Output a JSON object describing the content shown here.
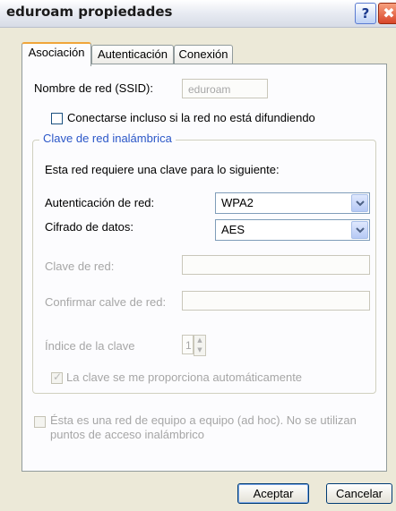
{
  "window": {
    "title": "eduroam propiedades"
  },
  "titlebar": {
    "help_glyph": "?",
    "close_glyph": "✖"
  },
  "tabs": [
    {
      "label": "Asociación",
      "active": true
    },
    {
      "label": "Autenticación",
      "active": false
    },
    {
      "label": "Conexión",
      "active": false
    }
  ],
  "ssid": {
    "label": "Nombre de red (SSID):",
    "value": "eduroam"
  },
  "broadcast_checkbox": {
    "label": "Conectarse incluso si la red no está difundiendo",
    "checked": false
  },
  "wireless_key": {
    "legend": "Clave de red inalámbrica",
    "intro": "Esta red requiere una clave para lo siguiente:",
    "auth_label": "Autenticación de red:",
    "auth_value": "WPA2",
    "cipher_label": "Cifrado de datos:",
    "cipher_value": "AES",
    "key_label": "Clave de red:",
    "confirm_label": "Confirmar calve de red:",
    "index_label": "Índice de la clave",
    "index_value": "1",
    "auto_key_label": "La clave se me proporciona automáticamente",
    "auto_key_checked": true
  },
  "adhoc": {
    "line1": "Ésta es una red de equipo a equipo (ad hoc). No se utilizan",
    "line2": "puntos de acceso inalámbrico",
    "checked": false
  },
  "buttons": {
    "ok": "Aceptar",
    "cancel": "Cancelar"
  },
  "colors": {
    "dialog_bg": "#ece9d8",
    "groupbox_label": "#2b57c8",
    "disabled_text": "#a6a6a6"
  },
  "icons": [
    "help-icon",
    "close-icon",
    "chevron-down-icon",
    "spinner-up-icon",
    "spinner-down-icon",
    "checkmark-icon"
  ]
}
